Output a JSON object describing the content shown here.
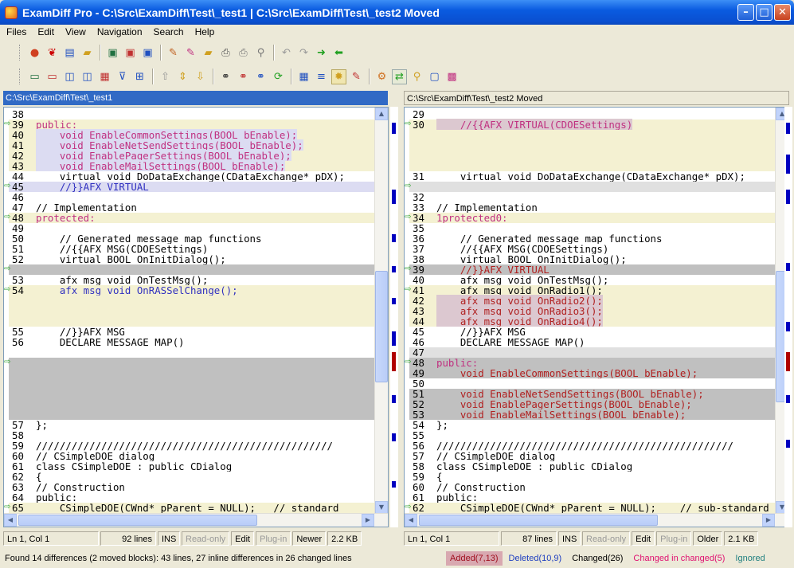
{
  "window": {
    "title": "ExamDiff Pro - C:\\Src\\ExamDiff\\Test\\_test1  |  C:\\Src\\ExamDiff\\Test\\_test2 Moved"
  },
  "menu": [
    "Files",
    "Edit",
    "View",
    "Navigation",
    "Search",
    "Help"
  ],
  "icons": {
    "row1": [
      "open-icon",
      "cherries-icon",
      "compare-files-icon",
      "compare-folders-icon",
      "save-icon",
      "save-as-icon",
      "save-all-icon",
      "edit-icon",
      "edit2-icon",
      "open-folder-icon",
      "print-icon",
      "print-preview-icon",
      "print-setup-icon",
      "undo-icon",
      "redo-icon",
      "next-arrow-icon",
      "prev-arrow-icon"
    ],
    "row2": [
      "view1-icon",
      "view2-icon",
      "view3-icon",
      "view4-icon",
      "view5-icon",
      "filter-icon",
      "options-icon",
      "first-diff-icon",
      "next-diff-icon",
      "prev-diff-icon",
      "find-icon",
      "find-next-icon",
      "find-prev-icon",
      "refresh-icon",
      "layout-icon",
      "lines-icon",
      "sun-icon",
      "notes-icon",
      "gear-icon",
      "sync-icon",
      "zoom-icon",
      "comment-icon",
      "palette-icon"
    ]
  },
  "left": {
    "path": "C:\\Src\\ExamDiff\\Test\\_test1",
    "status": {
      "pos": "Ln 1, Col 1",
      "lines": "92 lines",
      "ins": "INS",
      "readonly": "Read-only",
      "edit": "Edit",
      "plugin": "Plug-in",
      "age": "Newer",
      "size": "2.2 KB"
    },
    "rows": [
      {
        "n": "38",
        "t": "",
        "bg": "#fff"
      },
      {
        "n": "39",
        "t": "public:",
        "bg": "#f4f1d2",
        "fg": "#c03080",
        "arrow": true
      },
      {
        "n": "40",
        "t": "    void EnableCommonSettings(BOOL bEnable);",
        "bg": "#f4f1d2",
        "fg": "#c03080",
        "hl": "#dcdcf2"
      },
      {
        "n": "41",
        "t": "    void EnableNetSendSettings(BOOL bEnable);",
        "bg": "#f4f1d2",
        "fg": "#c03080",
        "hl": "#dcdcf2"
      },
      {
        "n": "42",
        "t": "    void EnablePagerSettings(BOOL bEnable);",
        "bg": "#f4f1d2",
        "fg": "#c03080",
        "hl": "#dcdcf2"
      },
      {
        "n": "43",
        "t": "    void EnableMailSettings(BOOL bEnable);",
        "bg": "#f4f1d2",
        "fg": "#c03080",
        "hl": "#dcdcf2"
      },
      {
        "n": "44",
        "t": "    virtual void DoDataExchange(CDataExchange* pDX);",
        "bg": "#fff"
      },
      {
        "n": "45",
        "t": "    //}}AFX_VIRTUAL",
        "bg": "#dcdcf2",
        "fg": "#3030c0",
        "arrow": true
      },
      {
        "n": "46",
        "t": "",
        "bg": "#fff"
      },
      {
        "n": "47",
        "t": "// Implementation",
        "bg": "#fff"
      },
      {
        "n": "48",
        "t": "protected:",
        "bg": "#f4f1d2",
        "fg": "#c03080",
        "arrow": true
      },
      {
        "n": "49",
        "t": "",
        "bg": "#fff"
      },
      {
        "n": "50",
        "t": "    // Generated message map functions",
        "bg": "#fff"
      },
      {
        "n": "51",
        "t": "    //{{AFX_MSG(CDOESettings)",
        "bg": "#fff"
      },
      {
        "n": "52",
        "t": "    virtual BOOL OnInitDialog();",
        "bg": "#fff"
      },
      {
        "n": "",
        "t": "",
        "bg": "#c0c0c0",
        "arrow": true
      },
      {
        "n": "53",
        "t": "    afx_msg void OnTestMsg();",
        "bg": "#fff"
      },
      {
        "n": "54",
        "t": "    afx_msg void OnRASSelChange();",
        "bg": "#f4f1d2",
        "fg": "#3030c0",
        "arrow": true
      },
      {
        "n": "",
        "t": "",
        "bg": "#f4f1d2"
      },
      {
        "n": "",
        "t": "",
        "bg": "#f4f1d2"
      },
      {
        "n": "",
        "t": "",
        "bg": "#f4f1d2"
      },
      {
        "n": "55",
        "t": "    //}}AFX_MSG",
        "bg": "#fff"
      },
      {
        "n": "56",
        "t": "    DECLARE_MESSAGE_MAP()",
        "bg": "#fff"
      },
      {
        "n": "",
        "t": "",
        "bg": "#fff"
      },
      {
        "n": "",
        "t": "",
        "bg": "#c0c0c0",
        "arrow": true
      },
      {
        "n": "",
        "t": "",
        "bg": "#c0c0c0"
      },
      {
        "n": "",
        "t": "",
        "bg": "#c0c0c0"
      },
      {
        "n": "",
        "t": "",
        "bg": "#c0c0c0"
      },
      {
        "n": "",
        "t": "",
        "bg": "#c0c0c0"
      },
      {
        "n": "",
        "t": "",
        "bg": "#c0c0c0"
      },
      {
        "n": "57",
        "t": "};",
        "bg": "#fff"
      },
      {
        "n": "58",
        "t": "",
        "bg": "#fff"
      },
      {
        "n": "59",
        "t": "//////////////////////////////////////////////////",
        "bg": "#fff"
      },
      {
        "n": "60",
        "t": "// CSimpleDOE dialog",
        "bg": "#fff"
      },
      {
        "n": "61",
        "t": "class CSimpleDOE : public CDialog",
        "bg": "#fff"
      },
      {
        "n": "62",
        "t": "{",
        "bg": "#fff"
      },
      {
        "n": "63",
        "t": "// Construction",
        "bg": "#fff"
      },
      {
        "n": "64",
        "t": "public:",
        "bg": "#fff"
      },
      {
        "n": "65",
        "t": "    CSimpleDOE(CWnd* pParent = NULL);   // standard",
        "bg": "#f4f1d2",
        "arrow": true
      }
    ]
  },
  "right": {
    "path": "C:\\Src\\ExamDiff\\Test\\_test2 Moved",
    "status": {
      "pos": "Ln 1, Col 1",
      "lines": "87 lines",
      "ins": "INS",
      "readonly": "Read-only",
      "edit": "Edit",
      "plugin": "Plug-in",
      "age": "Older",
      "size": "2.1 KB"
    },
    "rows": [
      {
        "n": "29",
        "t": "",
        "bg": "#fff"
      },
      {
        "n": "30",
        "t": "    //{{AFX_VIRTUAL(CDOESettings)",
        "bg": "#f4f1d2",
        "fg": "#c03080",
        "hl": "#dcc8d0",
        "arrow": true
      },
      {
        "n": "",
        "t": "",
        "bg": "#f4f1d2"
      },
      {
        "n": "",
        "t": "",
        "bg": "#f4f1d2"
      },
      {
        "n": "",
        "t": "",
        "bg": "#f4f1d2"
      },
      {
        "n": "",
        "t": "",
        "bg": "#f4f1d2"
      },
      {
        "n": "31",
        "t": "    virtual void DoDataExchange(CDataExchange* pDX);",
        "bg": "#fff"
      },
      {
        "n": "",
        "t": "",
        "bg": "#e0e0e0",
        "arrow": true
      },
      {
        "n": "32",
        "t": "",
        "bg": "#fff"
      },
      {
        "n": "33",
        "t": "// Implementation",
        "bg": "#fff"
      },
      {
        "n": "34",
        "t": "1protected0:",
        "bg": "#f4f1d2",
        "fg": "#c03080",
        "arrow": true
      },
      {
        "n": "35",
        "t": "",
        "bg": "#fff"
      },
      {
        "n": "36",
        "t": "    // Generated message map functions",
        "bg": "#fff"
      },
      {
        "n": "37",
        "t": "    //{{AFX_MSG(CDOESettings)",
        "bg": "#fff"
      },
      {
        "n": "38",
        "t": "    virtual BOOL OnInitDialog();",
        "bg": "#fff"
      },
      {
        "n": "39",
        "t": "    //}}AFX_VIRTUAL",
        "bg": "#c0c0c0",
        "fg": "#b02020",
        "arrow": true
      },
      {
        "n": "40",
        "t": "    afx_msg void OnTestMsg();",
        "bg": "#fff"
      },
      {
        "n": "41",
        "t": "    afx_msg void OnRadio1();",
        "bg": "#f4f1d2",
        "arrow": true
      },
      {
        "n": "42",
        "t": "    afx_msg void OnRadio2();",
        "bg": "#f4f1d2",
        "fg": "#b02020",
        "hl": "#dcc8d0"
      },
      {
        "n": "43",
        "t": "    afx_msg void OnRadio3();",
        "bg": "#f4f1d2",
        "fg": "#b02020",
        "hl": "#dcc8d0"
      },
      {
        "n": "44",
        "t": "    afx_msg void OnRadio4();",
        "bg": "#f4f1d2",
        "fg": "#b02020",
        "hl": "#dcc8d0"
      },
      {
        "n": "45",
        "t": "    //}}AFX_MSG",
        "bg": "#fff"
      },
      {
        "n": "46",
        "t": "    DECLARE_MESSAGE_MAP()",
        "bg": "#fff"
      },
      {
        "n": "47",
        "t": "",
        "bg": "#e0e0e0"
      },
      {
        "n": "48",
        "t": "public:",
        "bg": "#c0c0c0",
        "fg": "#c03080",
        "arrow": true
      },
      {
        "n": "49",
        "t": "    void EnableCommonSettings(BOOL bEnable);",
        "bg": "#c0c0c0",
        "fg": "#b02020"
      },
      {
        "n": "50",
        "t": "",
        "bg": "#fff"
      },
      {
        "n": "51",
        "t": "    void EnableNetSendSettings(BOOL bEnable);",
        "bg": "#c0c0c0",
        "fg": "#b02020"
      },
      {
        "n": "52",
        "t": "    void EnablePagerSettings(BOOL bEnable);",
        "bg": "#c0c0c0",
        "fg": "#b02020"
      },
      {
        "n": "53",
        "t": "    void EnableMailSettings(BOOL bEnable);",
        "bg": "#c0c0c0",
        "fg": "#b02020"
      },
      {
        "n": "54",
        "t": "};",
        "bg": "#fff"
      },
      {
        "n": "55",
        "t": "",
        "bg": "#fff"
      },
      {
        "n": "56",
        "t": "//////////////////////////////////////////////////",
        "bg": "#fff"
      },
      {
        "n": "57",
        "t": "// CSimpleDOE dialog",
        "bg": "#fff"
      },
      {
        "n": "58",
        "t": "class CSimpleDOE : public CDialog",
        "bg": "#fff"
      },
      {
        "n": "59",
        "t": "{",
        "bg": "#fff"
      },
      {
        "n": "60",
        "t": "// Construction",
        "bg": "#fff"
      },
      {
        "n": "61",
        "t": "public:",
        "bg": "#fff"
      },
      {
        "n": "62",
        "t": "    CSimpleDOE(CWnd* pParent = NULL);    // sub-standard",
        "bg": "#f4f1d2",
        "arrow": true
      }
    ]
  },
  "summary": "Found 14 differences (2 moved blocks): 43 lines, 27 inline differences in 26 changed lines",
  "legend": [
    {
      "label": "Added(7,13)",
      "bg": "#d8a8b0",
      "fg": "#a01020"
    },
    {
      "label": "Deleted(10,9)",
      "bg": "#ece9d8",
      "fg": "#2040c0"
    },
    {
      "label": "Changed(26)",
      "bg": "#ece9d8",
      "fg": "#000"
    },
    {
      "label": "Changed in changed(5)",
      "bg": "#ece9d8",
      "fg": "#e01070"
    },
    {
      "label": "Ignored",
      "bg": "#ece9d8",
      "fg": "#208080"
    }
  ],
  "colors": {
    "gutter_added": "#e05050",
    "gutter_changed": "#c8c8c8",
    "diffmap_added": "#b00000",
    "diffmap_deleted": "#0000c0"
  }
}
